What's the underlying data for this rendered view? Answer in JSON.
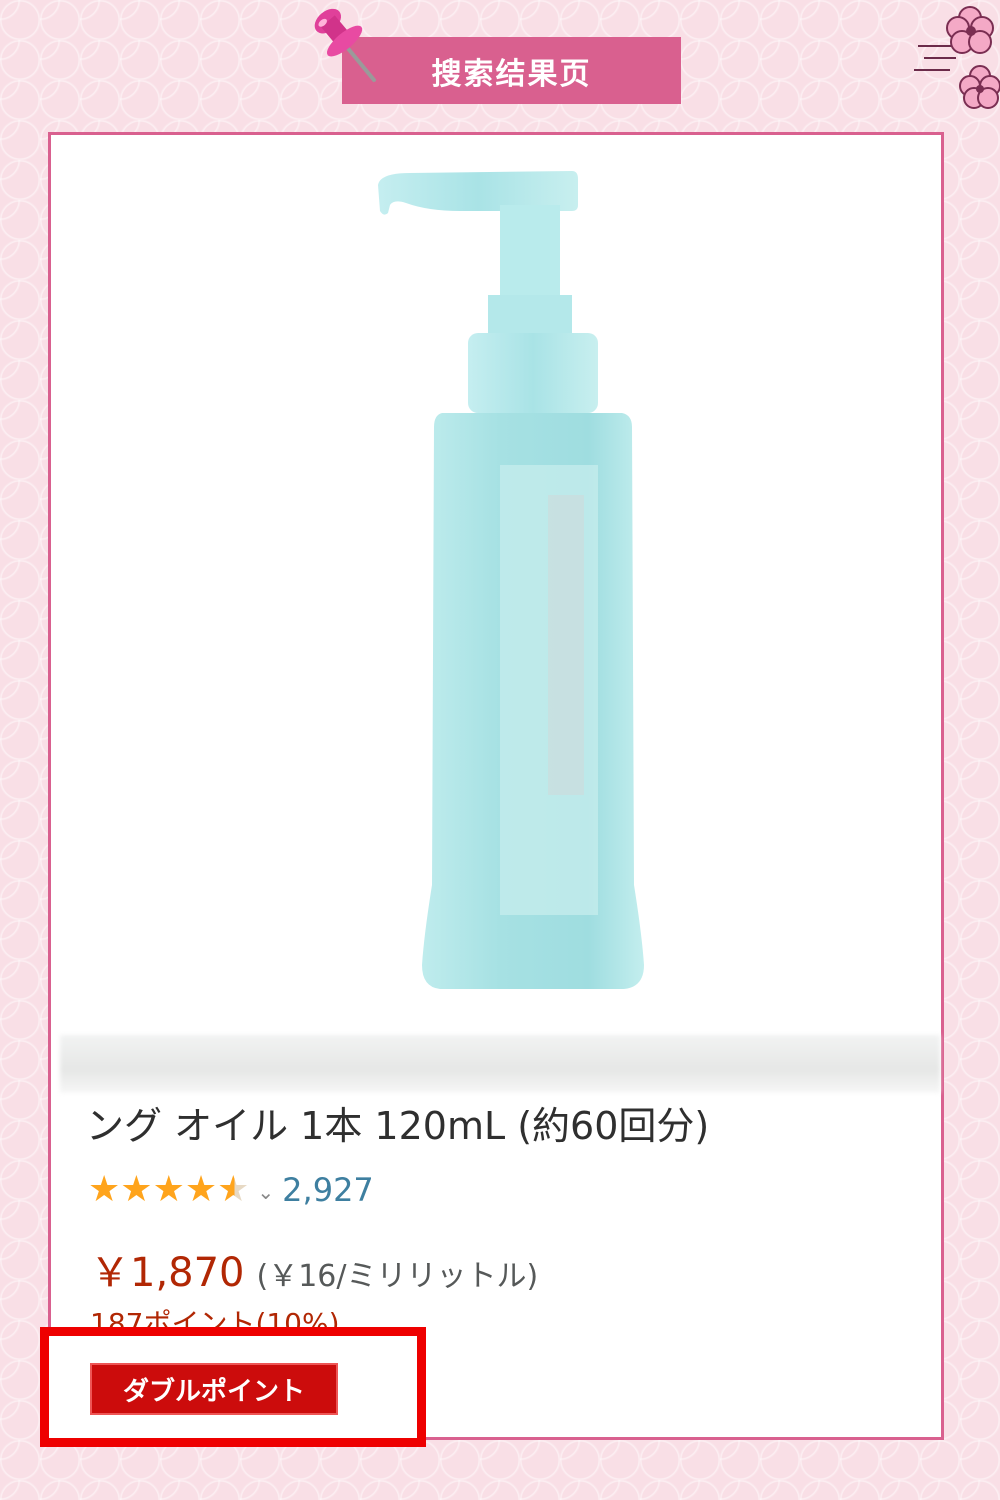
{
  "header": {
    "title": "搜索结果页"
  },
  "product": {
    "title": "ング オイル 1本 120mL (約60回分)",
    "rating": 4.5,
    "rating_max": 5,
    "review_count": "2,927",
    "price": "￥1,870",
    "unit_price": "(￥16/ミリリットル)",
    "points": "187ポイント(10%)",
    "tag": "ダブルポイント"
  },
  "colors": {
    "accent_pink": "#d9608f",
    "price_red": "#b12704",
    "star_orange": "#ffa41c",
    "highlight_red": "#ee0000",
    "bottle_aqua": "#a9e3e4"
  },
  "icons": [
    "push-pin-icon",
    "cherry-blossom-icon",
    "star-icon",
    "chevron-down-icon"
  ]
}
